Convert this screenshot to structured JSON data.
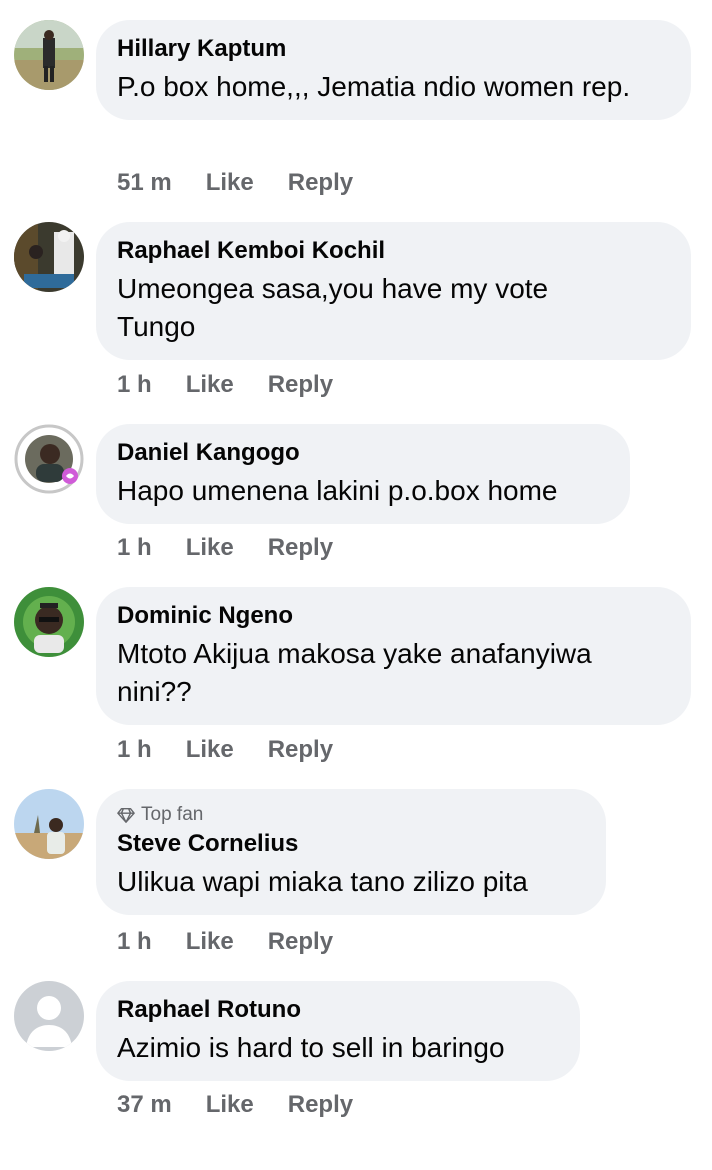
{
  "comments": [
    {
      "author": "Hillary Kaptum",
      "text": "P.o box home,,, Jematia ndio women rep.",
      "time": "51 m",
      "like": "Like",
      "reply": "Reply",
      "badge": ""
    },
    {
      "author": "Raphael Kemboi Kochil",
      "text": "Umeongea sasa,you have my vote Tungo",
      "time": "1 h",
      "like": "Like",
      "reply": "Reply",
      "badge": ""
    },
    {
      "author": "Daniel Kangogo",
      "text": "Hapo umenena lakini p.o.box home",
      "time": "1 h",
      "like": "Like",
      "reply": "Reply",
      "badge": ""
    },
    {
      "author": "Dominic Ngeno",
      "text": "Mtoto Akijua makosa yake anafanyiwa nini??",
      "time": "1 h",
      "like": "Like",
      "reply": "Reply",
      "badge": ""
    },
    {
      "author": "Steve Cornelius",
      "text": "Ulikua wapi miaka tano zilizo pita",
      "time": "1 h",
      "like": "Like",
      "reply": "Reply",
      "badge": "Top fan"
    },
    {
      "author": "Raphael Rotuno",
      "text": "Azimio is hard to sell in baringo",
      "time": "37 m",
      "like": "Like",
      "reply": "Reply",
      "badge": ""
    }
  ],
  "icons": {
    "top_fan": "diamond-icon",
    "default_avatar": "default-avatar-icon"
  },
  "colors": {
    "bubble": "#f0f2f5",
    "meta": "#65676b",
    "text": "#050505"
  }
}
